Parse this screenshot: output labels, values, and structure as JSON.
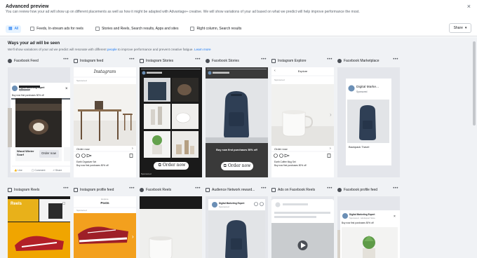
{
  "header": {
    "title": "Advanced preview",
    "subtitle": "You can review how your ad will show up on different placements as well as how it might be adapted with Advantage+ creative. We will show variations of your ad based on what we predict will help improve performance the most.",
    "share_label": "Share"
  },
  "filters": [
    {
      "label": "All",
      "active": true
    },
    {
      "label": "Feeds, In-stream ads for reels"
    },
    {
      "label": "Stories and Reels, Search results, Apps and sites"
    },
    {
      "label": "Right column, Search results"
    }
  ],
  "section": {
    "title": "Ways your ad will be seen",
    "subtitle_prefix": "We'll show variations of your ad we predict will resonate with different ",
    "people_link": "people",
    "subtitle_suffix": " to improve performance and prevent creative fatigue. ",
    "learn_more": "Learn more"
  },
  "placements_row1": [
    "Facebook Feed",
    "Instagram feed",
    "Instagram Stories",
    "Facebook Stories",
    "Instagram Explore",
    "Facebook Marketplace"
  ],
  "placements_row2": [
    "Instagram Reels",
    "Instagram profile feed",
    "Facebook Reels",
    "Audience Network reward...",
    "Ads on Facebook Reels",
    "Facebook profile feed"
  ],
  "ad": {
    "page_name": "Digital Marketing Expert",
    "sponsored": "Sponsored",
    "caption": "Buy now first purchases 50% off",
    "order_now": "Order now",
    "wood_winter": "Wood Winter Scarf",
    "like": "Like",
    "comment": "Comment",
    "share": "Share",
    "instagram_logo": "Instagram",
    "explore_title": "Explore",
    "ig_caption": "Earth Organizer Set",
    "ig_caption2": "Buy now first purchases 50% off",
    "explore_caption": "Earth Coffee Mug Set",
    "marketplace_name": "Digital Marke...",
    "backpack": "Backpack Travel",
    "reels_label": "Reels",
    "profile_title": "Posts",
    "profile_sub": "Explore",
    "fb_profile_name": "Digital Marketing Expert",
    "fb_profile_sponsored": "Sponsored · Adv.Expert Store"
  },
  "colors": {
    "accent": "#1877f2",
    "frame": "#e4e6eb"
  }
}
